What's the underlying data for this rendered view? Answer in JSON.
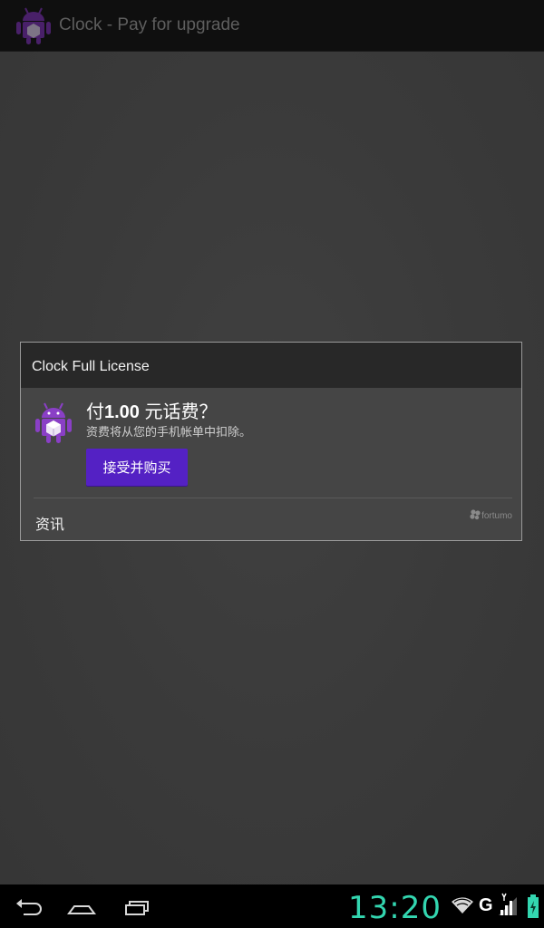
{
  "action_bar": {
    "title": "Clock - Pay for upgrade",
    "icon": "android-robot-icon"
  },
  "dialog": {
    "title": "Clock Full License",
    "price_prefix": "付",
    "price_amount": "1.00",
    "price_suffix": " 元话费？",
    "note": "资费将从您的手机帐单中扣除。",
    "buy_label": "接受并购买",
    "info_label": "资讯",
    "provider": "fortumo",
    "icon": "android-robot-icon"
  },
  "system_bar": {
    "time": "13:20",
    "network_type": "G",
    "icons": [
      "back-icon",
      "home-icon",
      "recent-apps-icon",
      "wifi-icon",
      "signal-icon",
      "battery-icon"
    ]
  },
  "colors": {
    "accent_button": "#5421c4",
    "clock": "#33d6b0",
    "icon_purple": "#8a3fc6"
  }
}
